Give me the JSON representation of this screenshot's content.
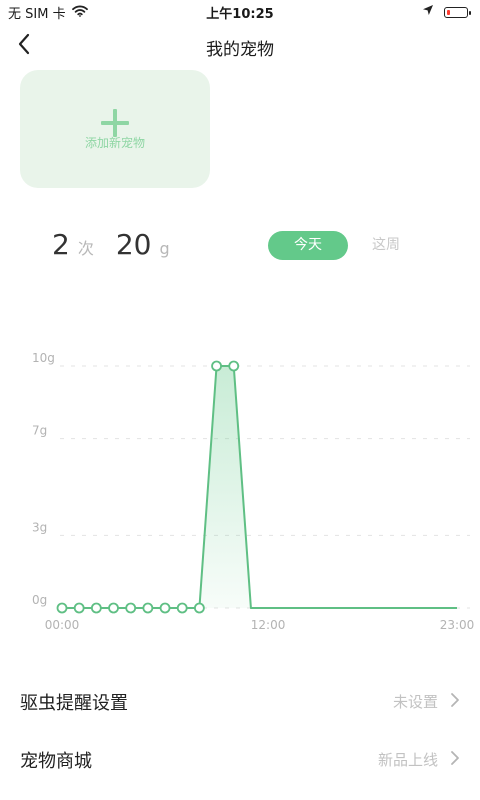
{
  "status_bar": {
    "carrier": "无 SIM 卡",
    "time": "上午10:25",
    "icons": [
      "wifi-icon",
      "location-arrow-icon",
      "battery-low-icon"
    ]
  },
  "nav": {
    "title": "我的宠物",
    "back_icon": "chevron-left-icon"
  },
  "add_pet": {
    "label": "添加新宠物",
    "icon": "plus-icon"
  },
  "stats": {
    "count": "2",
    "count_unit": "次",
    "amount": "20",
    "amount_unit": "g"
  },
  "period_toggle": {
    "today": "今天",
    "week": "这周",
    "selected": "today"
  },
  "colors": {
    "accent": "#63c98a",
    "card_bg": "#e9f4ea",
    "line": "#5fbf84"
  },
  "chart_data": {
    "type": "area",
    "title": "",
    "xlabel": "",
    "ylabel": "",
    "y_tick_labels": [
      "10g",
      "7g",
      "3g",
      "0g"
    ],
    "y_tick_values": [
      10,
      7,
      3,
      0
    ],
    "x_tick_labels": [
      "00:00",
      "12:00",
      "23:00"
    ],
    "x_tick_values": [
      0,
      12,
      23
    ],
    "ylim": [
      0,
      10
    ],
    "xlim": [
      0,
      23
    ],
    "grid": true,
    "series": [
      {
        "x": [
          0,
          1,
          2,
          3,
          4,
          5,
          6,
          7,
          8,
          9,
          10
        ],
        "y": [
          0,
          0,
          0,
          0,
          0,
          0,
          0,
          0,
          0,
          10,
          10
        ],
        "markers": true
      },
      {
        "x": [
          10,
          11,
          23
        ],
        "y": [
          10,
          0,
          0
        ],
        "markers": false
      }
    ]
  },
  "settings": [
    {
      "title": "驱虫提醒设置",
      "value": "未设置"
    },
    {
      "title": "宠物商城",
      "value": "新品上线"
    }
  ]
}
